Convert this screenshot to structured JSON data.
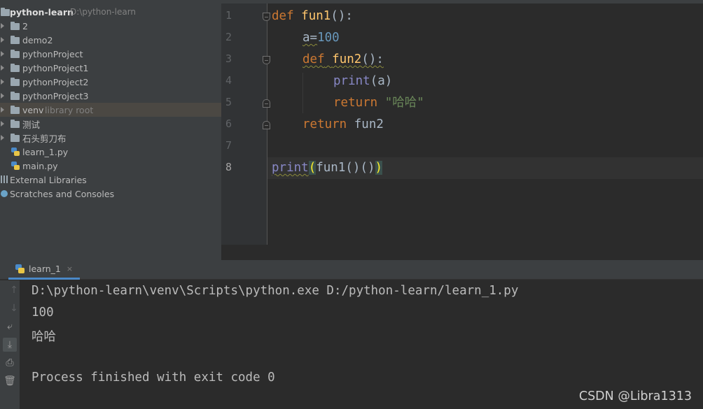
{
  "project_tree": {
    "root": {
      "name": "python-learn",
      "path": "D:\\python-learn"
    },
    "items": [
      {
        "label": "2",
        "type": "folder"
      },
      {
        "label": "demo2",
        "type": "folder"
      },
      {
        "label": "pythonProject",
        "type": "folder"
      },
      {
        "label": "pythonProject1",
        "type": "folder"
      },
      {
        "label": "pythonProject2",
        "type": "folder"
      },
      {
        "label": "pythonProject3",
        "type": "folder"
      },
      {
        "label": "venv",
        "hint": "library root",
        "type": "folder",
        "selected": true
      },
      {
        "label": "测试",
        "type": "folder"
      },
      {
        "label": "石头剪刀布",
        "type": "folder"
      },
      {
        "label": "learn_1.py",
        "type": "python-file"
      },
      {
        "label": "main.py",
        "type": "python-file"
      }
    ],
    "external_libraries": "External Libraries",
    "scratches": "Scratches and Consoles"
  },
  "editor": {
    "line_numbers": [
      "1",
      "2",
      "3",
      "4",
      "5",
      "6",
      "7",
      "8"
    ],
    "current_line": 8,
    "code": {
      "l1_kw": "def",
      "l1_fn": "fun1",
      "l1_rest": "():",
      "l2_var": "a=",
      "l2_num": "100",
      "l3_kw": "def",
      "l3_fn": "fun2",
      "l3_rest": "():",
      "l4_builtin": "print",
      "l4_rest": "(a)",
      "l5_kw": "return",
      "l5_str": "\"哈哈\"",
      "l6_kw": "return",
      "l6_rest": "fun2",
      "l8_builtin": "print",
      "l8_open": "(",
      "l8_mid": "fun1()()",
      "l8_close": ")"
    }
  },
  "run_panel": {
    "tab_label": "learn_1",
    "tab_close": "×",
    "console": [
      "D:\\python-learn\\venv\\Scripts\\python.exe D:/python-learn/learn_1.py",
      "100",
      "哈哈",
      "",
      "Process finished with exit code 0"
    ],
    "toolbar_icons": [
      "arrow-up-icon",
      "arrow-down-icon",
      "soft-wrap-icon",
      "scroll-to-end-icon",
      "print-icon",
      "trash-icon"
    ]
  },
  "watermark": "CSDN @Libra1313",
  "colors": {
    "keyword": "#cc7832",
    "function": "#ffc66d",
    "number": "#6897bb",
    "string": "#6a8759",
    "builtin": "#8888c6",
    "editor_bg": "#2b2b2b",
    "panel_bg": "#3c3f41"
  }
}
